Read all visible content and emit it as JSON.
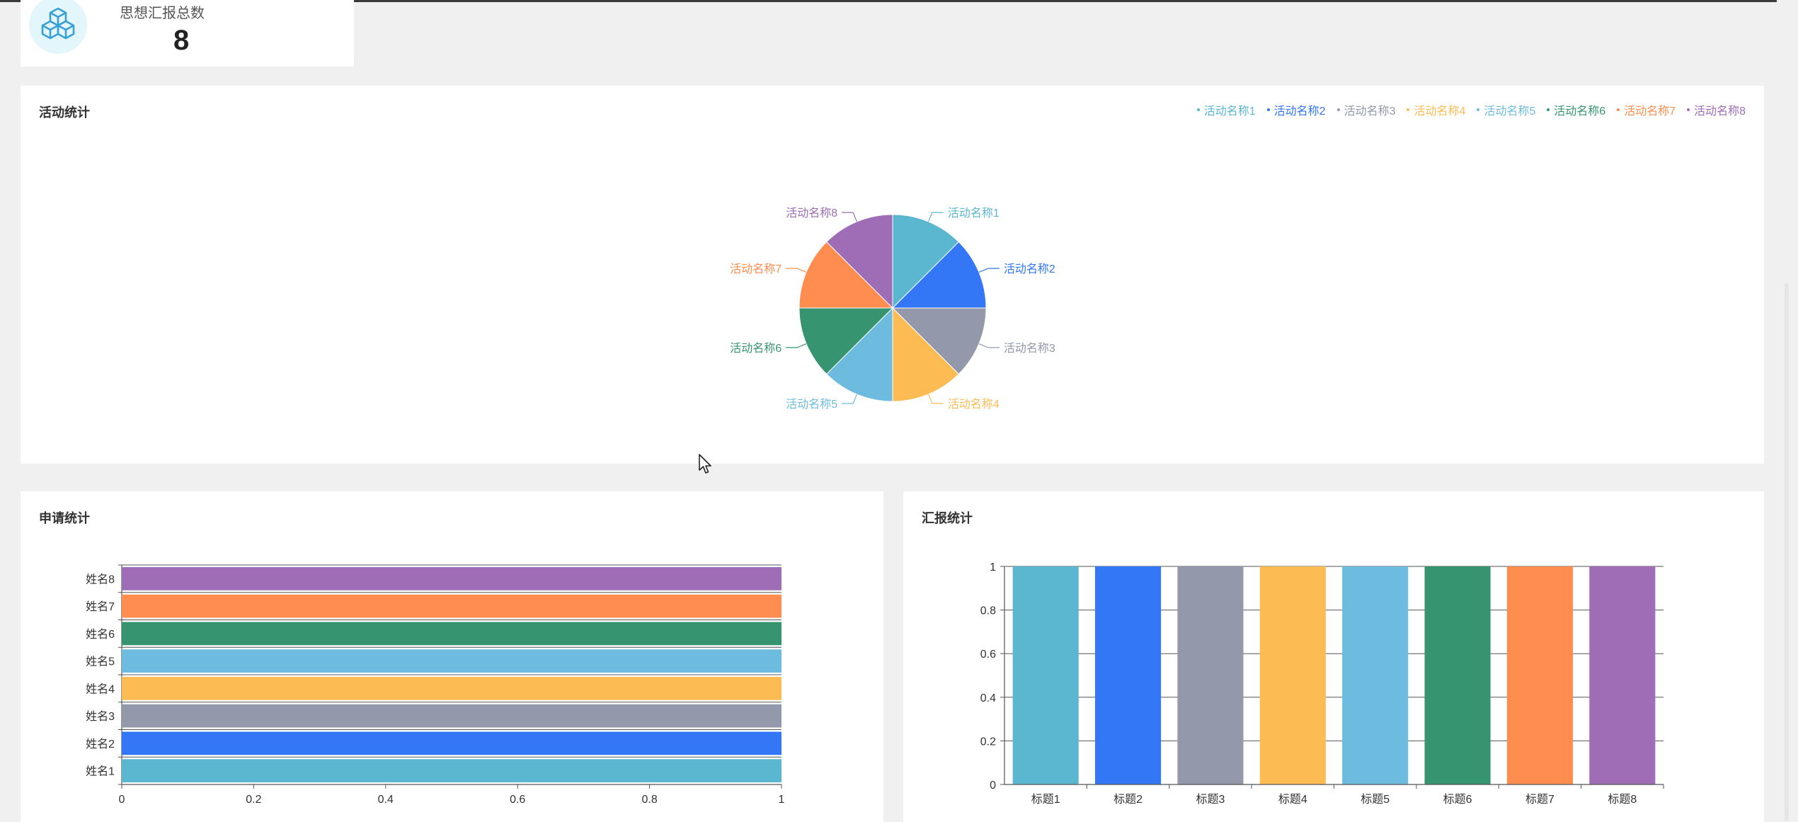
{
  "stat_card": {
    "label": "思想汇报总数",
    "value": "8",
    "icon": "cubes-icon"
  },
  "activity": {
    "title": "活动统计",
    "legend": [
      "活动名称1",
      "活动名称2",
      "活动名称3",
      "活动名称4",
      "活动名称5",
      "活动名称6",
      "活动名称7",
      "活动名称8"
    ]
  },
  "apply": {
    "title": "申请统计"
  },
  "report": {
    "title": "汇报统计"
  },
  "colors": [
    "#5bb6d0",
    "#3376f6",
    "#9398aa",
    "#fdbb54",
    "#6ebbe0",
    "#369570",
    "#fe8d4f",
    "#9e6db5"
  ],
  "chart_data": [
    {
      "type": "pie",
      "title": "活动统计",
      "labels": [
        "活动名称1",
        "活动名称2",
        "活动名称3",
        "活动名称4",
        "活动名称5",
        "活动名称6",
        "活动名称7",
        "活动名称8"
      ],
      "values": [
        1,
        1,
        1,
        1,
        1,
        1,
        1,
        1
      ],
      "legend": "top-right"
    },
    {
      "type": "bar",
      "orientation": "horizontal",
      "title": "申请统计",
      "categories": [
        "姓名1",
        "姓名2",
        "姓名3",
        "姓名4",
        "姓名5",
        "姓名6",
        "姓名7",
        "姓名8"
      ],
      "values": [
        1,
        1,
        1,
        1,
        1,
        1,
        1,
        1
      ],
      "xlim": [
        0,
        1
      ],
      "xticks": [
        "0",
        "0.2",
        "0.4",
        "0.6",
        "0.8",
        "1"
      ],
      "grid": true
    },
    {
      "type": "bar",
      "title": "汇报统计",
      "categories": [
        "标题1",
        "标题2",
        "标题3",
        "标题4",
        "标题5",
        "标题6",
        "标题7",
        "标题8"
      ],
      "values": [
        1,
        1,
        1,
        1,
        1,
        1,
        1,
        1
      ],
      "ylim": [
        0,
        1
      ],
      "yticks": [
        "0",
        "0.2",
        "0.4",
        "0.6",
        "0.8",
        "1"
      ],
      "grid": true
    }
  ]
}
